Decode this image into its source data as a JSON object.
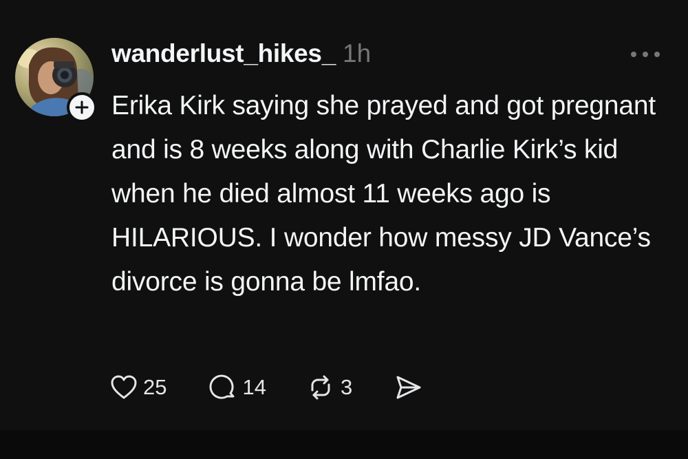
{
  "post": {
    "username": "wanderlust_hikes_",
    "timestamp": "1h",
    "text": "Erika Kirk saying she prayed and got pregnant and is 8 weeks along with Charlie Kirk’s kid when he died almost 11 weeks ago is HILARIOUS. I wonder how messy JD Vance’s divorce is gonna be lmfao.",
    "actions": {
      "likes": "25",
      "replies": "14",
      "reposts": "3"
    }
  },
  "icons": {
    "follow": "plus-icon",
    "more": "more-horizontal-icon",
    "like": "heart-icon",
    "reply": "speech-bubble-icon",
    "repost": "repost-arrows-icon",
    "share": "send-icon"
  },
  "colors": {
    "background": "#101010",
    "text": "#f3f5f7",
    "secondary": "#777777"
  }
}
